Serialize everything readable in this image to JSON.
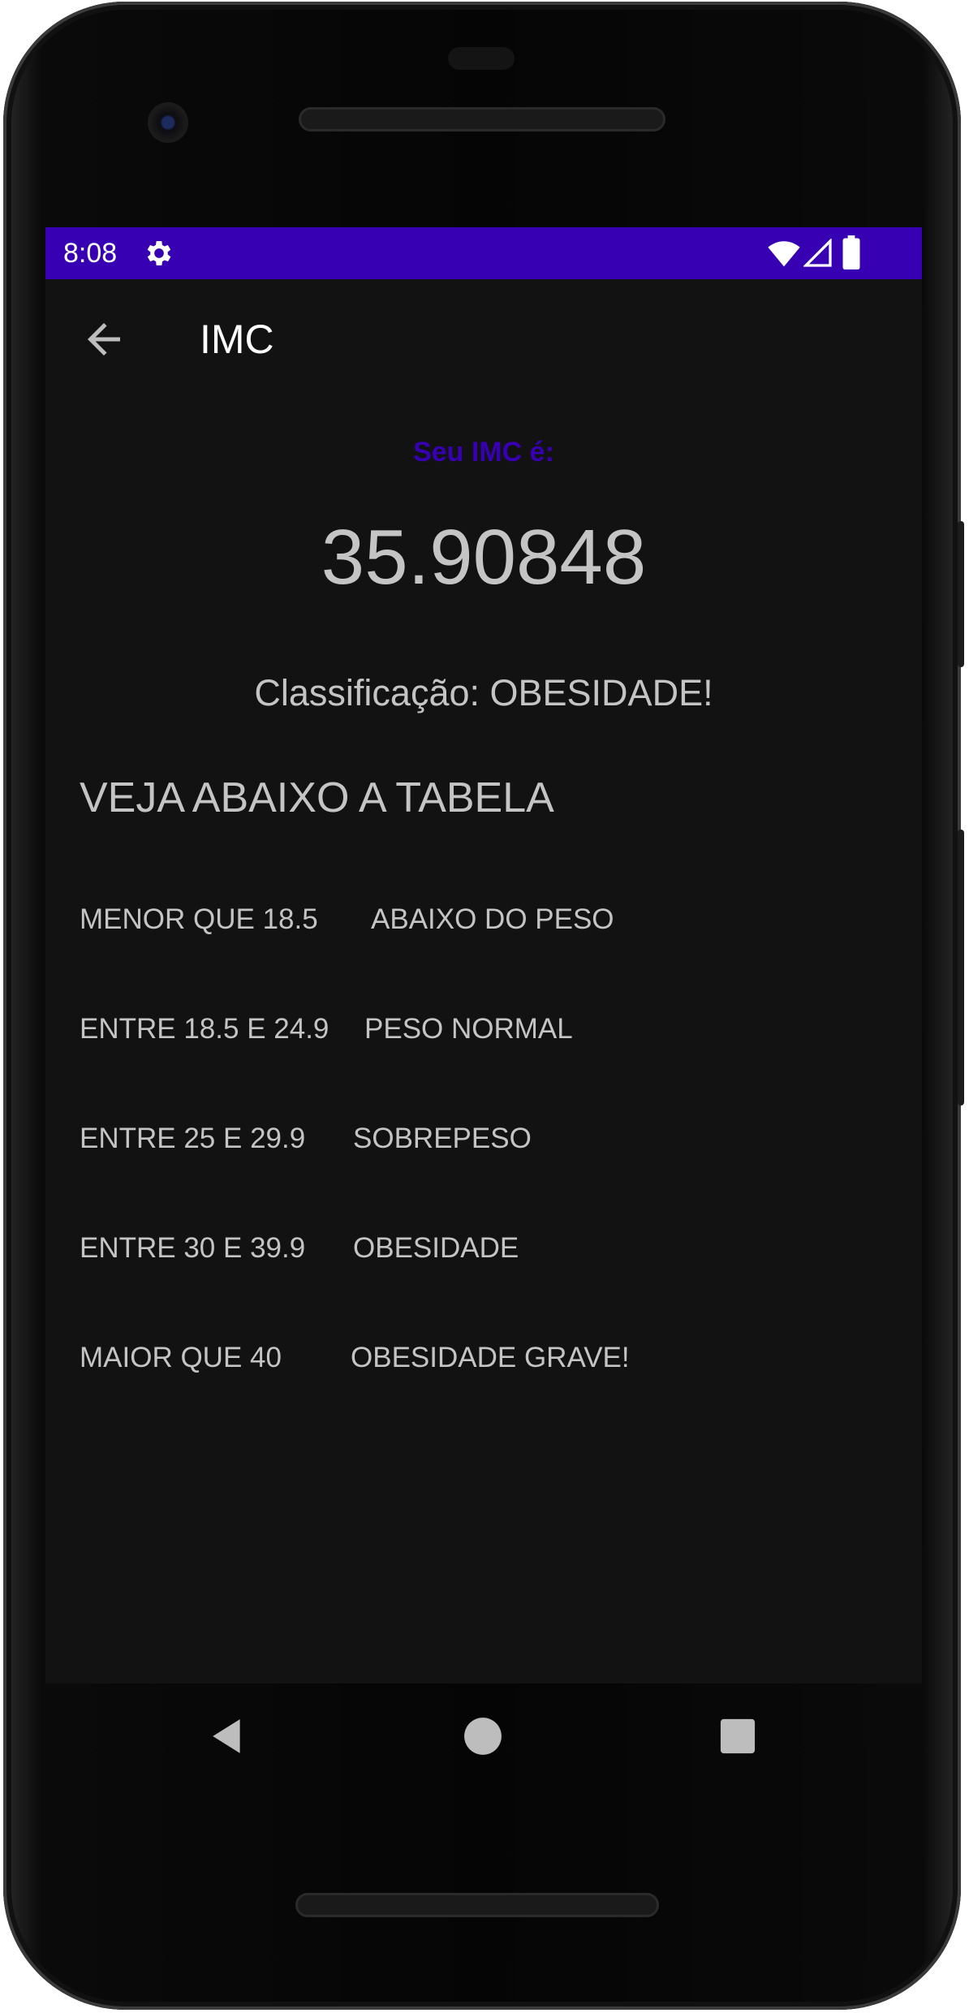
{
  "status_bar": {
    "time": "8:08",
    "background": "#3700b3",
    "icons": [
      "gear-icon",
      "wifi-icon",
      "cell-signal-icon",
      "battery-icon"
    ]
  },
  "toolbar": {
    "title": "IMC",
    "back_icon": "arrow-back-icon"
  },
  "result": {
    "label": "Seu IMC é:",
    "label_color": "#3700b3",
    "value": "35.90848",
    "classification": "Classificação: OBESIDADE!"
  },
  "table": {
    "title": "VEJA ABAIXO A TABELA",
    "rows": [
      {
        "range": "MENOR QUE 18.5",
        "class": "ABAIXO DO PESO"
      },
      {
        "range": "ENTRE 18.5 E 24.9",
        "class": "PESO NORMAL"
      },
      {
        "range": "ENTRE 25 E 29.9",
        "class": "SOBREPESO"
      },
      {
        "range": "ENTRE 30 E 39.9",
        "class": "OBESIDADE"
      },
      {
        "range": "MAIOR QUE 40",
        "class": "OBESIDADE GRAVE!"
      }
    ]
  },
  "nav_bar": {
    "icons": [
      "nav-back-icon",
      "nav-home-icon",
      "nav-recents-icon"
    ]
  },
  "colors": {
    "screen_background": "#121212",
    "text": "#c4c4c4",
    "accent": "#3700b3"
  }
}
